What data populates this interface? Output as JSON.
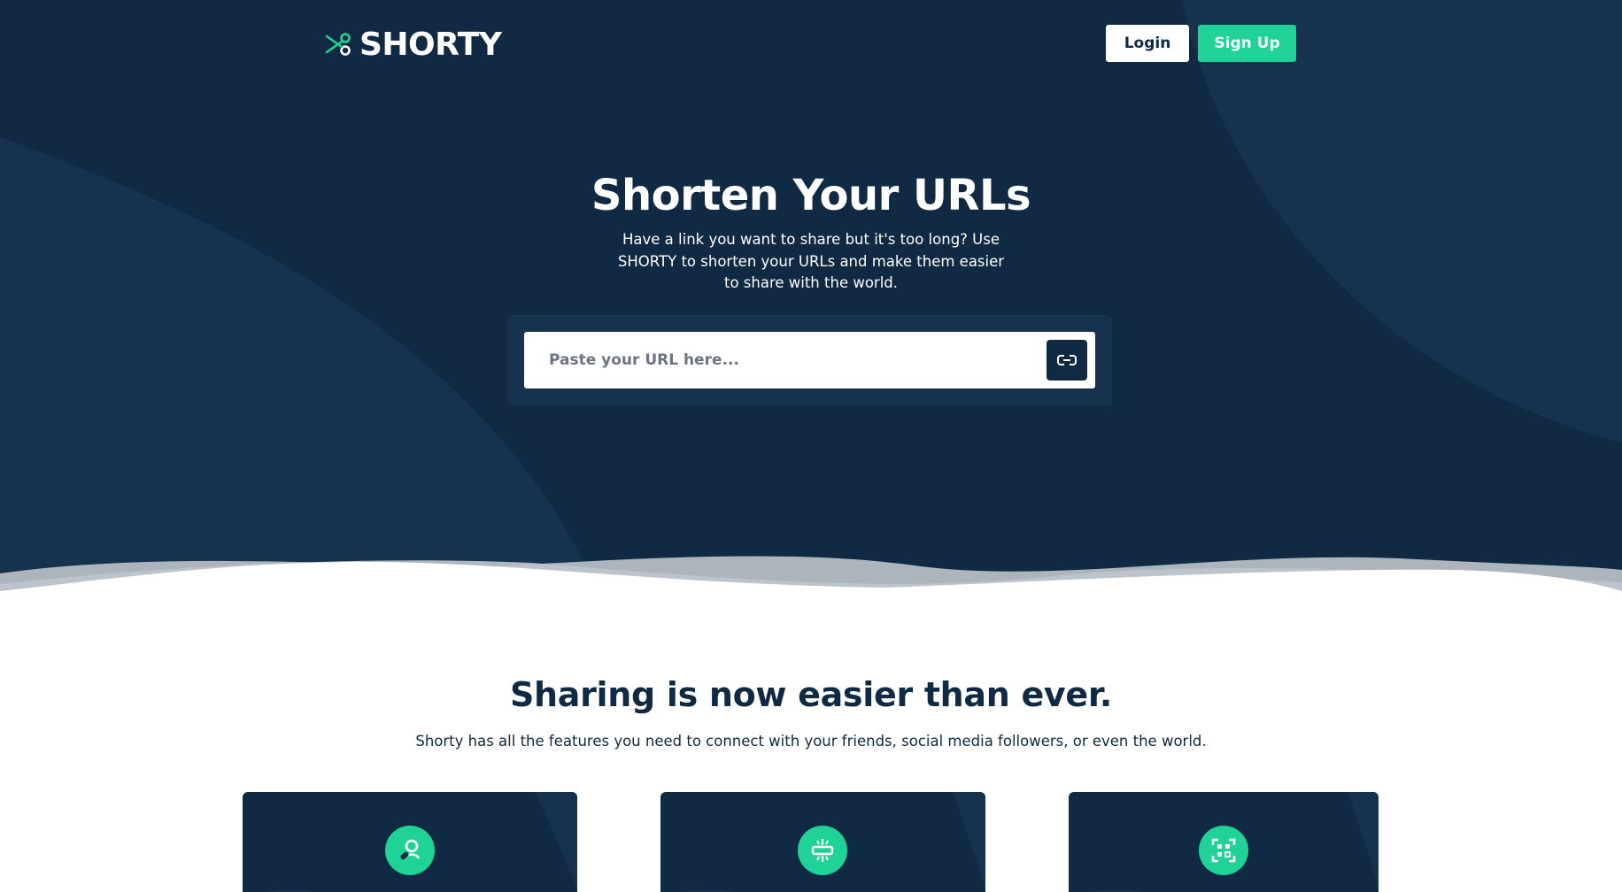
{
  "brand": {
    "name": "SHORTY",
    "logo_icon": "scissors-icon",
    "accent_color": "#1fd396",
    "navy_color": "#0f2a42"
  },
  "nav": {
    "login_label": "Login",
    "signup_label": "Sign Up"
  },
  "hero": {
    "title": "Shorten Your URLs",
    "description": "Have a link you want to share but it's too long? Use SHORTY to shorten your URLs and make them easier to share with the world.",
    "input_placeholder": "Paste your URL here...",
    "input_value": "",
    "submit_icon": "link-icon"
  },
  "features": {
    "title": "Sharing is now easier than ever.",
    "description": "Shorty has all the features you need to connect with your friends, social media followers, or even the world.",
    "cards": [
      {
        "icon": "user-link-icon"
      },
      {
        "icon": "compress-icon"
      },
      {
        "icon": "qr-code-icon"
      }
    ]
  }
}
